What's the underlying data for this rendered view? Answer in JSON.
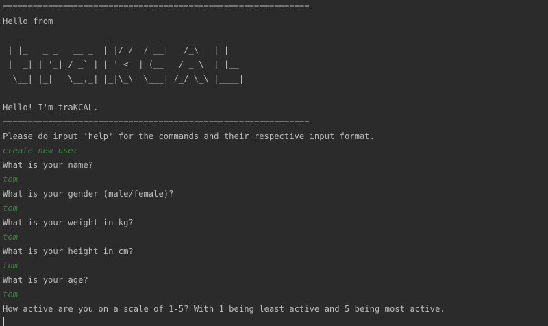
{
  "console": {
    "lines": [
      {
        "text": "=============================================================",
        "kind": "output"
      },
      {
        "text": "Hello from",
        "kind": "output"
      },
      {
        "text": "   _                 _  __   ___     _      _",
        "kind": "output"
      },
      {
        "text": " | |_   _ _   __ _  | |/ /  / __|   /_\\   | |",
        "kind": "output"
      },
      {
        "text": " |  _| | '_| / _` | | ' <  | (__   / _ \\  | |__",
        "kind": "output"
      },
      {
        "text": "  \\__| |_|   \\__,_| |_|\\_\\  \\___| /_/ \\_\\ |____|",
        "kind": "output"
      },
      {
        "text": "",
        "kind": "output"
      },
      {
        "text": "Hello! I'm traKCAL.",
        "kind": "output"
      },
      {
        "text": "=============================================================",
        "kind": "output"
      },
      {
        "text": "Please do input 'help' for the commands and their respective input format.",
        "kind": "output"
      },
      {
        "text": "create new user",
        "kind": "input"
      },
      {
        "text": "What is your name?",
        "kind": "output"
      },
      {
        "text": "tom",
        "kind": "input"
      },
      {
        "text": "What is your gender (male/female)?",
        "kind": "output"
      },
      {
        "text": "tom",
        "kind": "input"
      },
      {
        "text": "What is your weight in kg?",
        "kind": "output"
      },
      {
        "text": "tom",
        "kind": "input"
      },
      {
        "text": "What is your height in cm?",
        "kind": "output"
      },
      {
        "text": "tom",
        "kind": "input"
      },
      {
        "text": "What is your age?",
        "kind": "output"
      },
      {
        "text": "tom",
        "kind": "input"
      },
      {
        "text": "How active are you on a scale of 1-5? With 1 being least active and 5 being most active.",
        "kind": "output"
      }
    ]
  },
  "colors": {
    "background": "#2b2b2b",
    "output_text": "#bbbbbb",
    "input_text": "#2e8b2e"
  }
}
